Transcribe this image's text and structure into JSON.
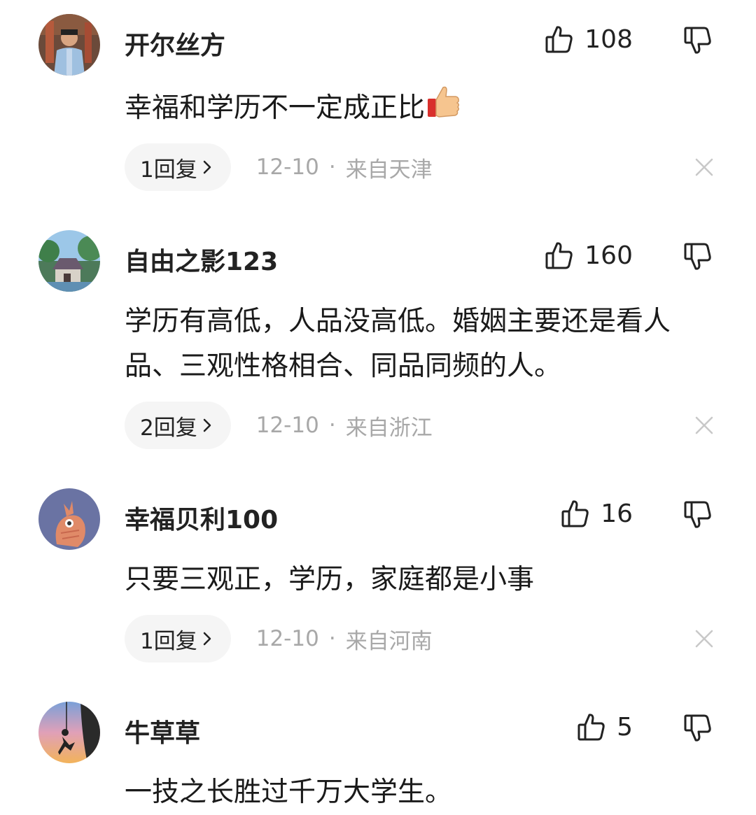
{
  "comments": [
    {
      "username": "开尔丝方",
      "likes": "108",
      "text": "幸福和学历不一定成正比",
      "has_thumb_emoji": true,
      "reply_label": "1回复",
      "date": "12-10",
      "dot": "·",
      "location": "来自天津"
    },
    {
      "username": "自由之影123",
      "likes": "160",
      "text": "学历有高低，人品没高低。婚姻主要还是看人品、三观性格相合、同品同频的人。",
      "has_thumb_emoji": false,
      "reply_label": "2回复",
      "date": "12-10",
      "dot": "·",
      "location": "来自浙江"
    },
    {
      "username": "幸福贝利100",
      "likes": "16",
      "text": "只要三观正，学历，家庭都是小事",
      "has_thumb_emoji": false,
      "reply_label": "1回复",
      "date": "12-10",
      "dot": "·",
      "location": "来自河南"
    },
    {
      "username": "牛草草",
      "likes": "5",
      "text": "一技之长胜过千万大学生。",
      "has_thumb_emoji": false
    }
  ],
  "icons": {
    "like": "thumbs-up-outline-icon",
    "dislike": "thumbs-down-outline-icon",
    "reply_chevron": "chevron-right-icon",
    "close": "close-x-icon",
    "emoji": "thumbs-up-emoji"
  },
  "colors": {
    "text_primary": "#1a1a1a",
    "text_meta": "#a8a8a8",
    "pill_bg": "#f5f5f5",
    "close_icon": "#c8c8c8"
  }
}
